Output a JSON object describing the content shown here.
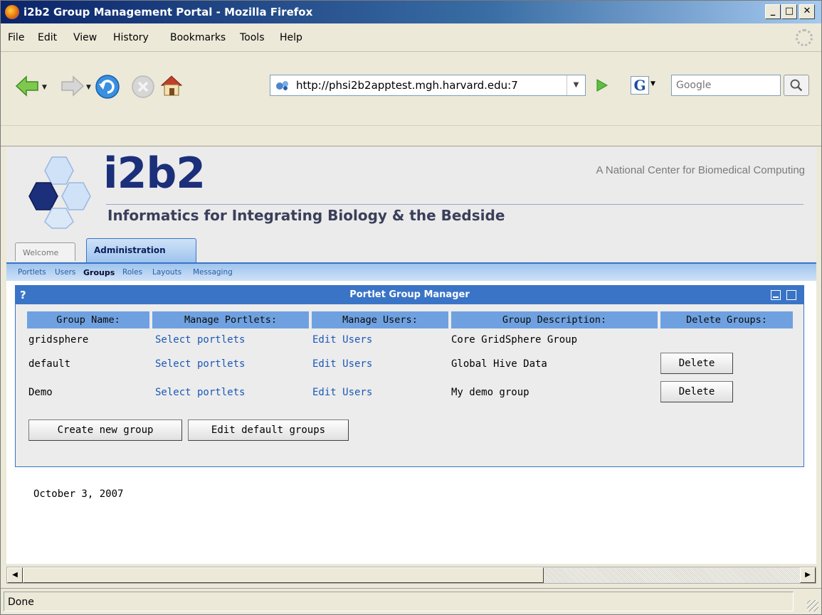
{
  "window": {
    "title": "i2b2 Group Management Portal - Mozilla Firefox",
    "min_label": "_",
    "max_label": "□",
    "close_label": "✕"
  },
  "menubar": {
    "items": [
      "File",
      "Edit",
      "View",
      "History",
      "Bookmarks",
      "Tools",
      "Help"
    ]
  },
  "navbar": {
    "url": "http://phsi2b2apptest.mgh.harvard.edu:7",
    "search_engine": "G",
    "search_placeholder": "Google"
  },
  "header": {
    "logo_text": "i2b2",
    "tagline": "Informatics for Integrating Biology & the Bedside",
    "national_center": "A National Center for Biomedical Computing"
  },
  "tabs": [
    {
      "label": "Welcome",
      "active": false
    },
    {
      "label": "Administration",
      "active": true
    }
  ],
  "subnav": {
    "items": [
      "Portlets",
      "Users",
      "Groups",
      "Roles",
      "Layouts",
      "Messaging"
    ],
    "active": "Groups"
  },
  "portlet": {
    "help_label": "?",
    "title": "Portlet Group Manager",
    "columns": [
      "Group Name:",
      "Manage Portlets:",
      "Manage Users:",
      "Group Description:",
      "Delete Groups:"
    ],
    "rows": [
      {
        "name": "gridsphere",
        "portlets": "Select portlets",
        "users": "Edit Users",
        "description": "Core GridSphere Group",
        "delete": ""
      },
      {
        "name": "default",
        "portlets": "Select portlets",
        "users": "Edit Users",
        "description": "Global Hive Data",
        "delete": "Delete"
      },
      {
        "name": "Demo",
        "portlets": "Select portlets",
        "users": "Edit Users",
        "description": "My demo group",
        "delete": "Delete"
      }
    ],
    "create_button": "Create new group",
    "edit_defaults_button": "Edit default groups"
  },
  "footer_date": "October 3, 2007",
  "status": {
    "text": "Done"
  },
  "colors": {
    "portlet_header": "#3a74c7",
    "column_header": "#6fa1e0",
    "link": "#1a58b8",
    "logo": "#1b2f7a"
  }
}
